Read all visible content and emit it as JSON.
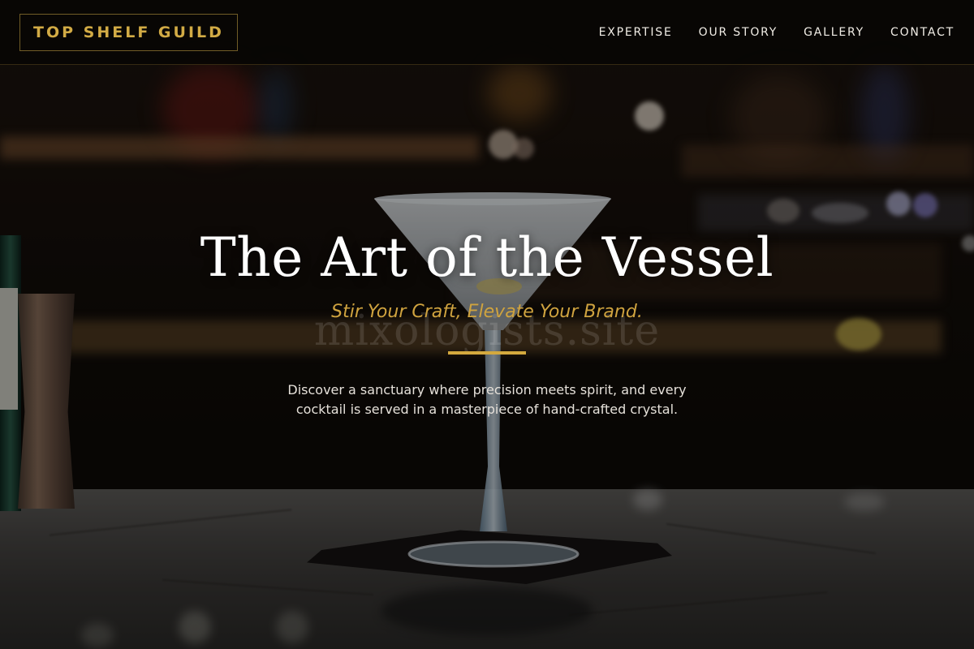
{
  "header": {
    "logo": "TOP SHELF GUILD",
    "nav": [
      {
        "label": "EXPERTISE"
      },
      {
        "label": "OUR STORY"
      },
      {
        "label": "GALLERY"
      },
      {
        "label": "CONTACT"
      }
    ]
  },
  "hero": {
    "title": "The Art of the Vessel",
    "watermark": "mixologists.site",
    "tagline": "Stir Your Craft, Elevate Your Brand.",
    "description": "Discover a sanctuary where precision meets spirit, and every cocktail is served in a masterpiece of hand-crafted crystal."
  },
  "colors": {
    "accent_gold": "#d4a93e",
    "header_bg": "#060504",
    "text_light": "#f1ede6"
  }
}
